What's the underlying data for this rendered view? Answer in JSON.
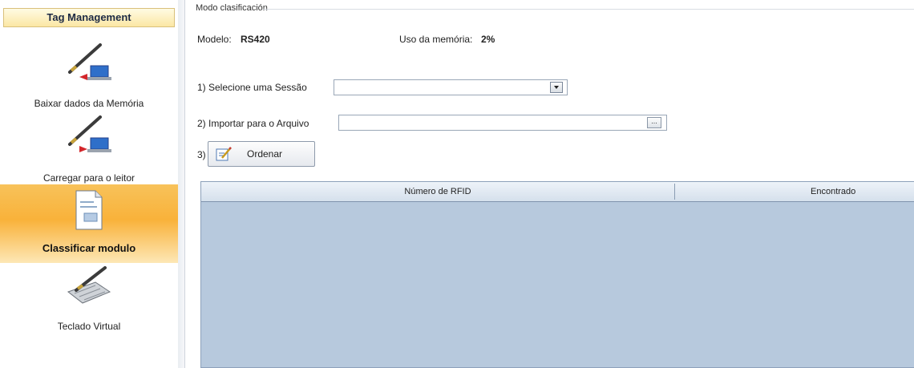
{
  "sidebar": {
    "header": "Tag Management",
    "items": [
      {
        "label": "Baixar dados da Memória",
        "icon": "pen-to-laptop-icon",
        "active": false
      },
      {
        "label": "Carregar para o leitor",
        "icon": "pen-to-laptop-icon",
        "active": false
      },
      {
        "label": "Classificar modulo",
        "icon": "document-icon",
        "active": true
      },
      {
        "label": "Teclado Virtual",
        "icon": "keyboard-pen-icon",
        "active": false
      }
    ]
  },
  "main": {
    "group_title": "Modo clasificación",
    "model_label": "Modelo:",
    "model_value": "RS420",
    "memory_label": "Uso da memória:",
    "memory_value": "2%",
    "step1_label": "1) Selecione uma Sessão",
    "step1_value": "",
    "step2_label": "2) Importar para o Arquivo",
    "step2_value": "",
    "step2_browse": "...",
    "step3_label": "3)",
    "order_button": "Ordenar",
    "grid": {
      "columns": [
        "Número de RFID",
        "Encontrado"
      ],
      "rows": []
    }
  },
  "colors": {
    "active_item": "#f9b23a",
    "grid_background": "#b7c9dd",
    "header_bg": "#fbe7a4"
  }
}
